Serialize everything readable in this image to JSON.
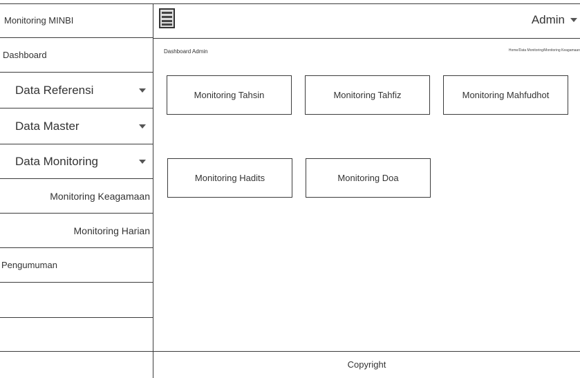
{
  "sidebar": {
    "brand": "Monitoring MINBI",
    "dashboard": "Dashboard",
    "data_referensi": "Data Referensi",
    "data_master": "Data Master",
    "data_monitoring": "Data Monitoring",
    "monitoring_keagamaan": "Monitoring Keagamaan",
    "monitoring_harian": "Monitoring Harian",
    "pengumuman": "Pengumuman"
  },
  "header": {
    "user": "Admin",
    "icons": {
      "menu": "menu-icon",
      "user_dropdown": "chevron-down-icon"
    }
  },
  "main": {
    "title": "Dashboard Admin",
    "breadcrumb": "Home/Data Monitoring/Monitoring Keagamaan",
    "tiles": [
      {
        "label": "Monitoring Tahsin"
      },
      {
        "label": "Monitoring Tahfiz"
      },
      {
        "label": "Monitoring Mahfudhot"
      },
      {
        "label": "Monitoring Hadits"
      },
      {
        "label": "Monitoring Doa"
      }
    ]
  },
  "footer": {
    "text": "Copyright"
  }
}
